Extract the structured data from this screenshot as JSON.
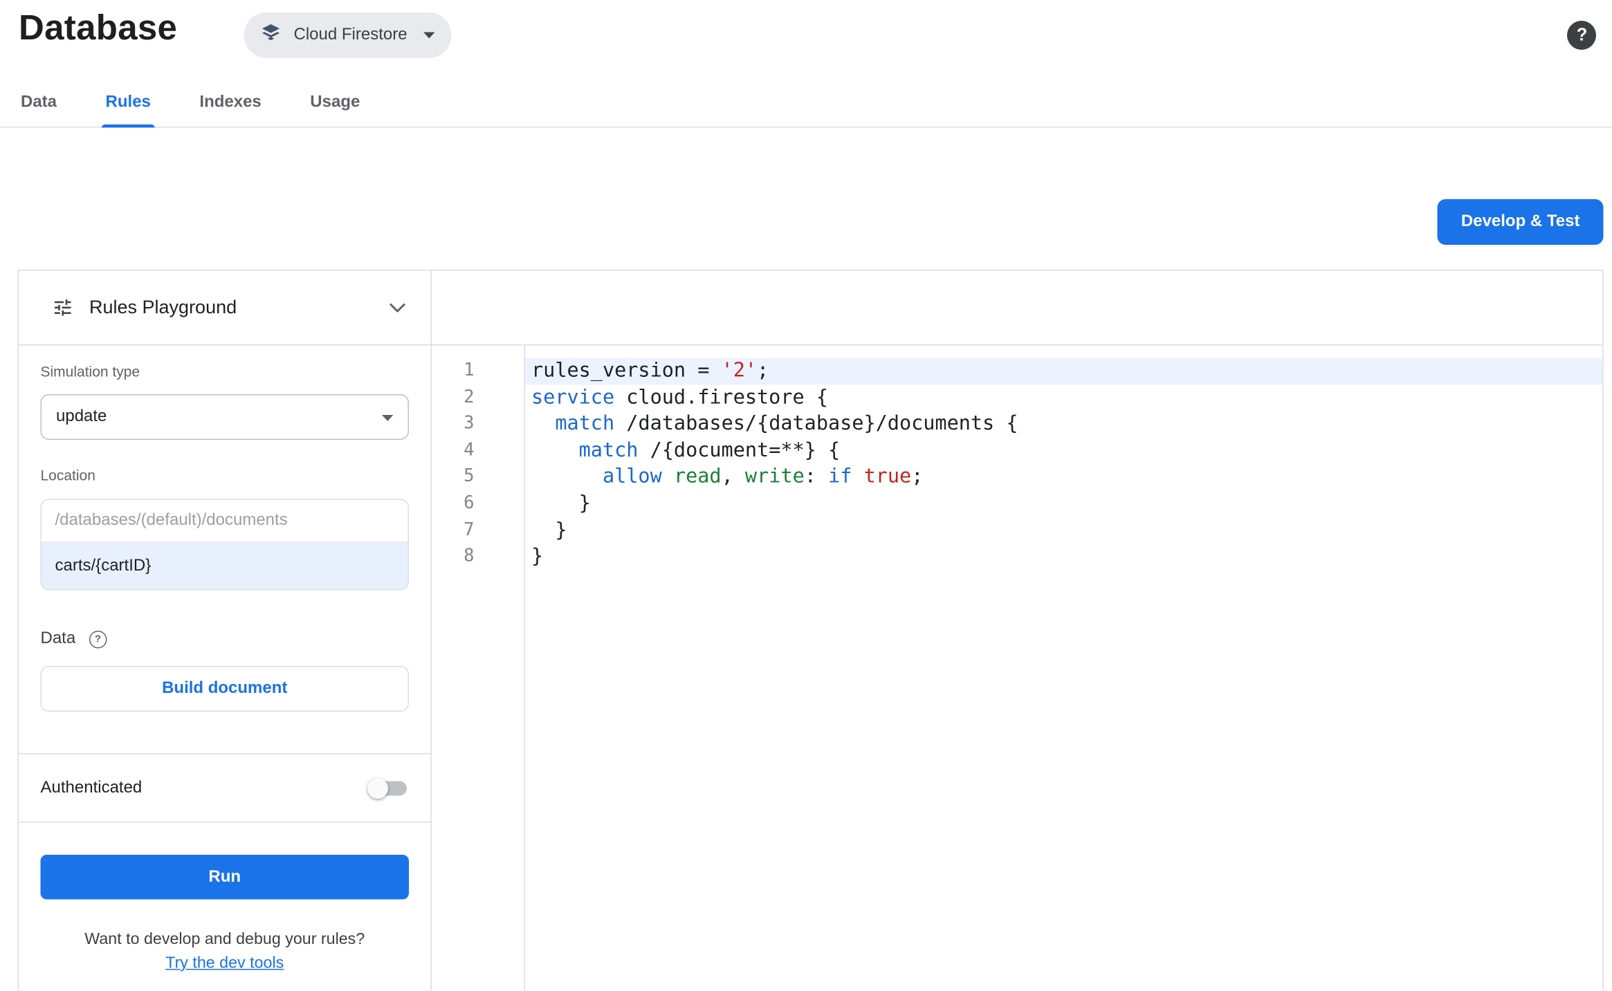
{
  "header": {
    "title": "Database",
    "product_selector": "Cloud Firestore",
    "help": "?"
  },
  "tabs": [
    {
      "label": "Data",
      "active": false
    },
    {
      "label": "Rules",
      "active": true
    },
    {
      "label": "Indexes",
      "active": false
    },
    {
      "label": "Usage",
      "active": false
    }
  ],
  "actions": {
    "develop_test": "Develop & Test"
  },
  "playground": {
    "title": "Rules Playground",
    "simulation_type_label": "Simulation type",
    "simulation_type_value": "update",
    "location_label": "Location",
    "location_placeholder": "/databases/(default)/documents",
    "location_value": "carts/{cartID}",
    "data_label": "Data",
    "data_help": "?",
    "build_document": "Build document",
    "authenticated_label": "Authenticated",
    "authenticated_on": false,
    "run": "Run",
    "footer_text": "Want to develop and debug your rules?",
    "footer_link": "Try the dev tools"
  },
  "editor": {
    "active_line": 1,
    "lines": [
      {
        "n": 1,
        "tokens": [
          [
            "p",
            "rules_version = "
          ],
          [
            "s",
            "'2'"
          ],
          [
            "p",
            ";"
          ]
        ]
      },
      {
        "n": 2,
        "tokens": [
          [
            "k",
            "service"
          ],
          [
            "p",
            " cloud.firestore {"
          ]
        ]
      },
      {
        "n": 3,
        "tokens": [
          [
            "p",
            "  "
          ],
          [
            "k",
            "match"
          ],
          [
            "p",
            " /databases/{database}/documents {"
          ]
        ]
      },
      {
        "n": 4,
        "tokens": [
          [
            "p",
            "    "
          ],
          [
            "k",
            "match"
          ],
          [
            "p",
            " /{document=**} {"
          ]
        ]
      },
      {
        "n": 5,
        "tokens": [
          [
            "p",
            "      "
          ],
          [
            "k",
            "allow"
          ],
          [
            "p",
            " "
          ],
          [
            "n",
            "read"
          ],
          [
            "p",
            ", "
          ],
          [
            "n",
            "write"
          ],
          [
            "p",
            ": "
          ],
          [
            "k",
            "if"
          ],
          [
            "p",
            " "
          ],
          [
            "s",
            "true"
          ],
          [
            "p",
            ";"
          ]
        ]
      },
      {
        "n": 6,
        "tokens": [
          [
            "p",
            "    }"
          ]
        ]
      },
      {
        "n": 7,
        "tokens": [
          [
            "p",
            "  }"
          ]
        ]
      },
      {
        "n": 8,
        "tokens": [
          [
            "p",
            "}"
          ]
        ]
      }
    ]
  },
  "colors": {
    "accent": "#1a73e8",
    "keyword": "#1967d2",
    "identifier": "#188038",
    "literal": "#c5221f",
    "active_line_bg": "#ecf3fe",
    "location_value_bg": "#e8f0fe"
  }
}
